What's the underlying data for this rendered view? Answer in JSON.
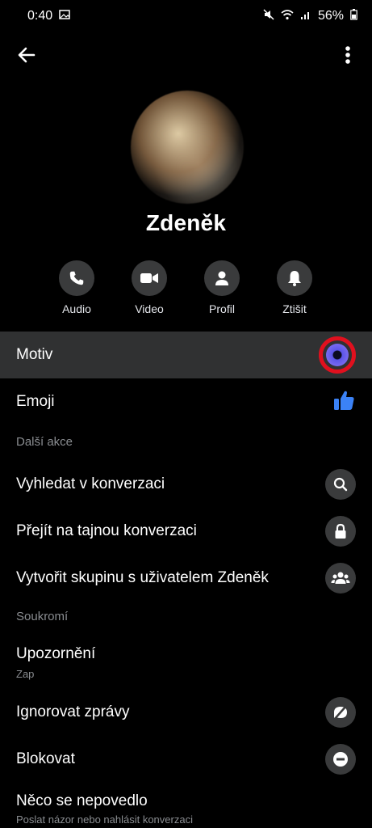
{
  "status": {
    "time": "0:40",
    "battery": "56%"
  },
  "header": {
    "back_icon": "arrow-left-icon",
    "more_icon": "more-vertical-icon"
  },
  "profile": {
    "name": "Zdeněk"
  },
  "actions": [
    {
      "label": "Audio",
      "icon": "phone-icon"
    },
    {
      "label": "Video",
      "icon": "video-icon"
    },
    {
      "label": "Profil",
      "icon": "person-icon"
    },
    {
      "label": "Ztišit",
      "icon": "bell-icon"
    }
  ],
  "rows": {
    "motiv": "Motiv",
    "emoji": "Emoji",
    "section_more": "Další akce",
    "search": "Vyhledat v konverzaci",
    "secret": "Přejít na tajnou konverzaci",
    "group": "Vytvořit skupinu s uživatelem Zdeněk",
    "section_privacy": "Soukromí",
    "notifications": "Upozornění",
    "notifications_sub": "Zap",
    "ignore": "Ignorovat zprávy",
    "block": "Blokovat",
    "problem": "Něco se nepovedlo",
    "problem_sub": "Poslat názor nebo nahlásit konverzaci"
  },
  "colors": {
    "accent_theme": "#5b55e8",
    "highlight_ring": "#e0101e",
    "like_blue": "#3b82f6"
  }
}
